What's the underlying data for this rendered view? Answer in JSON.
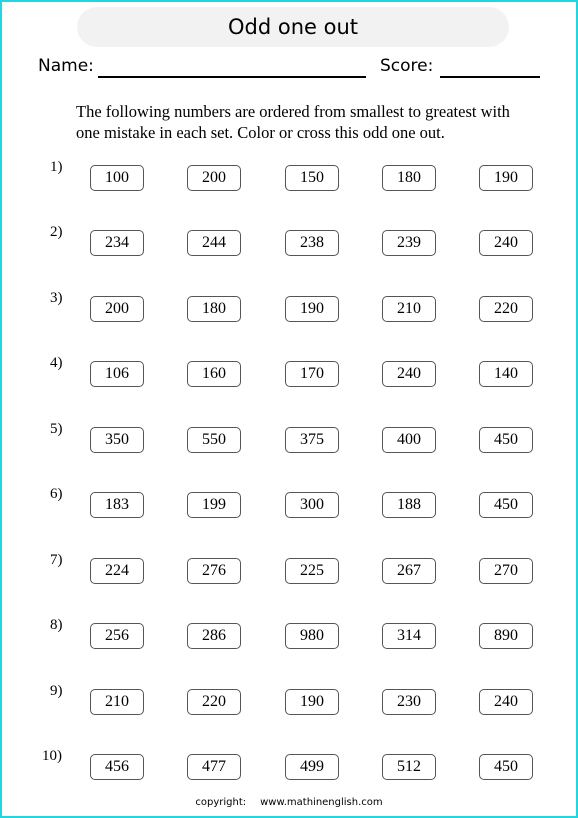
{
  "title": "Odd one out",
  "form": {
    "name_label": "Name:",
    "score_label": "Score:"
  },
  "instructions": "The following numbers are ordered from smallest to greatest with one mistake in each set. Color or cross this odd one out.",
  "questions": [
    {
      "label": "1)",
      "numbers": [
        "100",
        "200",
        "150",
        "180",
        "190"
      ]
    },
    {
      "label": "2)",
      "numbers": [
        "234",
        "244",
        "238",
        "239",
        "240"
      ]
    },
    {
      "label": "3)",
      "numbers": [
        "200",
        "180",
        "190",
        "210",
        "220"
      ]
    },
    {
      "label": "4)",
      "numbers": [
        "106",
        "160",
        "170",
        "240",
        "140"
      ]
    },
    {
      "label": "5)",
      "numbers": [
        "350",
        "550",
        "375",
        "400",
        "450"
      ]
    },
    {
      "label": "6)",
      "numbers": [
        "183",
        "199",
        "300",
        "188",
        "450"
      ]
    },
    {
      "label": "7)",
      "numbers": [
        "224",
        "276",
        "225",
        "267",
        "270"
      ]
    },
    {
      "label": "8)",
      "numbers": [
        "256",
        "286",
        "980",
        "314",
        "890"
      ]
    },
    {
      "label": "9)",
      "numbers": [
        "210",
        "220",
        "190",
        "230",
        "240"
      ]
    },
    {
      "label": "10)",
      "numbers": [
        "456",
        "477",
        "499",
        "512",
        "450"
      ]
    }
  ],
  "footer": {
    "copyright_label": "copyright:",
    "website": "www.mathinenglish.com"
  },
  "colors": {
    "frame_border": "#22d6e0",
    "title_background": "#f2f2f2"
  }
}
